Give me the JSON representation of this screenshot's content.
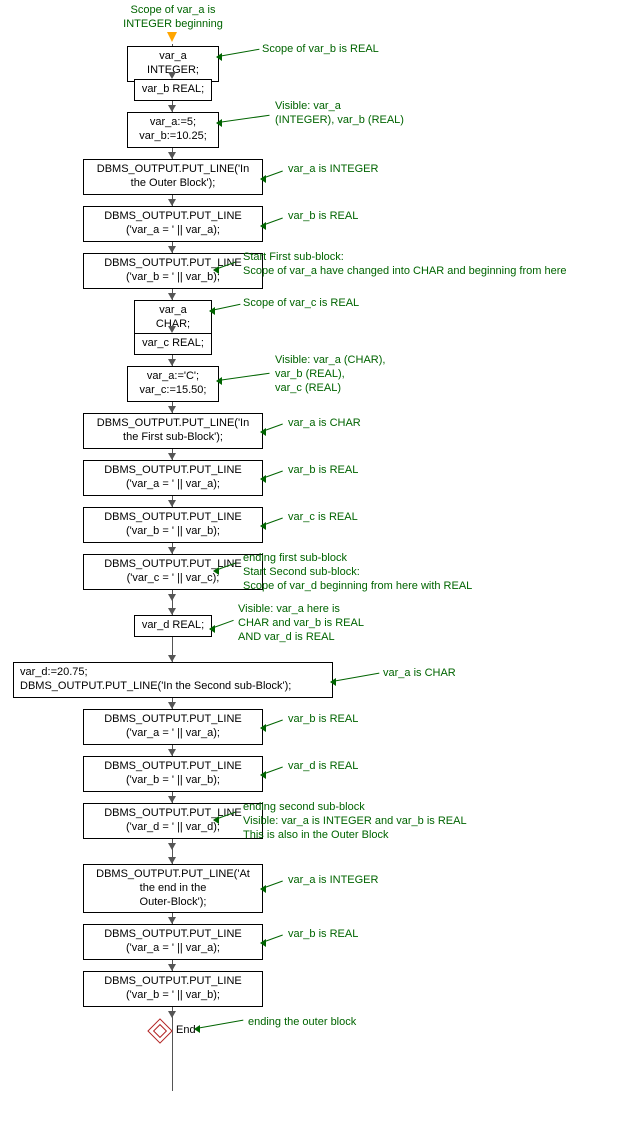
{
  "topAnnotation": "Scope of var_a is\nINTEGER beginning",
  "nodes": [
    {
      "id": "n1",
      "text": "var_a INTEGER;"
    },
    {
      "id": "n2",
      "text": "var_b REAL;"
    },
    {
      "id": "n3",
      "text": "var_a:=5;\nvar_b:=10.25;"
    },
    {
      "id": "n4",
      "text": "DBMS_OUTPUT.PUT_LINE('In\nthe Outer Block');"
    },
    {
      "id": "n5",
      "text": "DBMS_OUTPUT.PUT_LINE\n('var_a = ' || var_a);"
    },
    {
      "id": "n6",
      "text": "DBMS_OUTPUT.PUT_LINE\n('var_b = ' || var_b);"
    },
    {
      "id": "n7",
      "text": "var_a CHAR;"
    },
    {
      "id": "n8",
      "text": "var_c REAL;"
    },
    {
      "id": "n9",
      "text": "var_a:='C';\nvar_c:=15.50;"
    },
    {
      "id": "n10",
      "text": "DBMS_OUTPUT.PUT_LINE('In\nthe First sub-Block');"
    },
    {
      "id": "n11",
      "text": "DBMS_OUTPUT.PUT_LINE\n('var_a = ' || var_a);"
    },
    {
      "id": "n12",
      "text": "DBMS_OUTPUT.PUT_LINE\n('var_b = ' || var_b);"
    },
    {
      "id": "n13",
      "text": "DBMS_OUTPUT.PUT_LINE\n('var_c = ' || var_c);"
    },
    {
      "id": "n14",
      "text": "var_d REAL;"
    },
    {
      "id": "n15",
      "text": "var_d:=20.75;\nDBMS_OUTPUT.PUT_LINE('In the Second sub-Block');"
    },
    {
      "id": "n16",
      "text": "DBMS_OUTPUT.PUT_LINE\n('var_a = ' || var_a);"
    },
    {
      "id": "n17",
      "text": "DBMS_OUTPUT.PUT_LINE\n('var_b = ' || var_b);"
    },
    {
      "id": "n18",
      "text": "DBMS_OUTPUT.PUT_LINE\n('var_d = ' || var_d);"
    },
    {
      "id": "n19",
      "text": "DBMS_OUTPUT.PUT_LINE('At\nthe end in the\nOuter-Block');"
    },
    {
      "id": "n20",
      "text": "DBMS_OUTPUT.PUT_LINE\n('var_a = ' || var_a);"
    },
    {
      "id": "n21",
      "text": "DBMS_OUTPUT.PUT_LINE\n('var_b = ' || var_b);"
    }
  ],
  "edgeAnnotations": [
    {
      "id": "a1",
      "text": "Scope of var_b is REAL"
    },
    {
      "id": "a2",
      "text": "Visible: var_a\n(INTEGER), var_b (REAL)"
    },
    {
      "id": "a3",
      "text": "var_a  is INTEGER"
    },
    {
      "id": "a4",
      "text": "var_b is REAL"
    },
    {
      "id": "a5",
      "text": "Start First sub-block:\nScope of var_a have changed into CHAR and beginning from here"
    },
    {
      "id": "a6",
      "text": "Scope of var_c is REAL"
    },
    {
      "id": "a7",
      "text": "Visible: var_a (CHAR),\nvar_b (REAL),\nvar_c (REAL)"
    },
    {
      "id": "a8",
      "text": "var_a is CHAR"
    },
    {
      "id": "a9",
      "text": "var_b is REAL"
    },
    {
      "id": "a10",
      "text": "var_c is REAL"
    },
    {
      "id": "a11",
      "text": "ending first sub-block\nStart Second sub-block:\nScope of var_d beginning from here with REAL"
    },
    {
      "id": "a12",
      "text": "Visible: var_a here is\nCHAR and  var_b is REAL\nAND  var_d is REAL"
    },
    {
      "id": "a13",
      "text": "var_a is CHAR"
    },
    {
      "id": "a14",
      "text": "var_b is REAL"
    },
    {
      "id": "a15",
      "text": "var_d is REAL"
    },
    {
      "id": "a16",
      "text": "ending second sub-block\nVisible: var_a is INTEGER and var_b is REAL\nThis is also in the Outer Block"
    },
    {
      "id": "a17",
      "text": "var_a  is INTEGER"
    },
    {
      "id": "a18",
      "text": "var_b is REAL"
    },
    {
      "id": "a19",
      "text": "ending the outer block"
    }
  ],
  "endLabel": "End"
}
